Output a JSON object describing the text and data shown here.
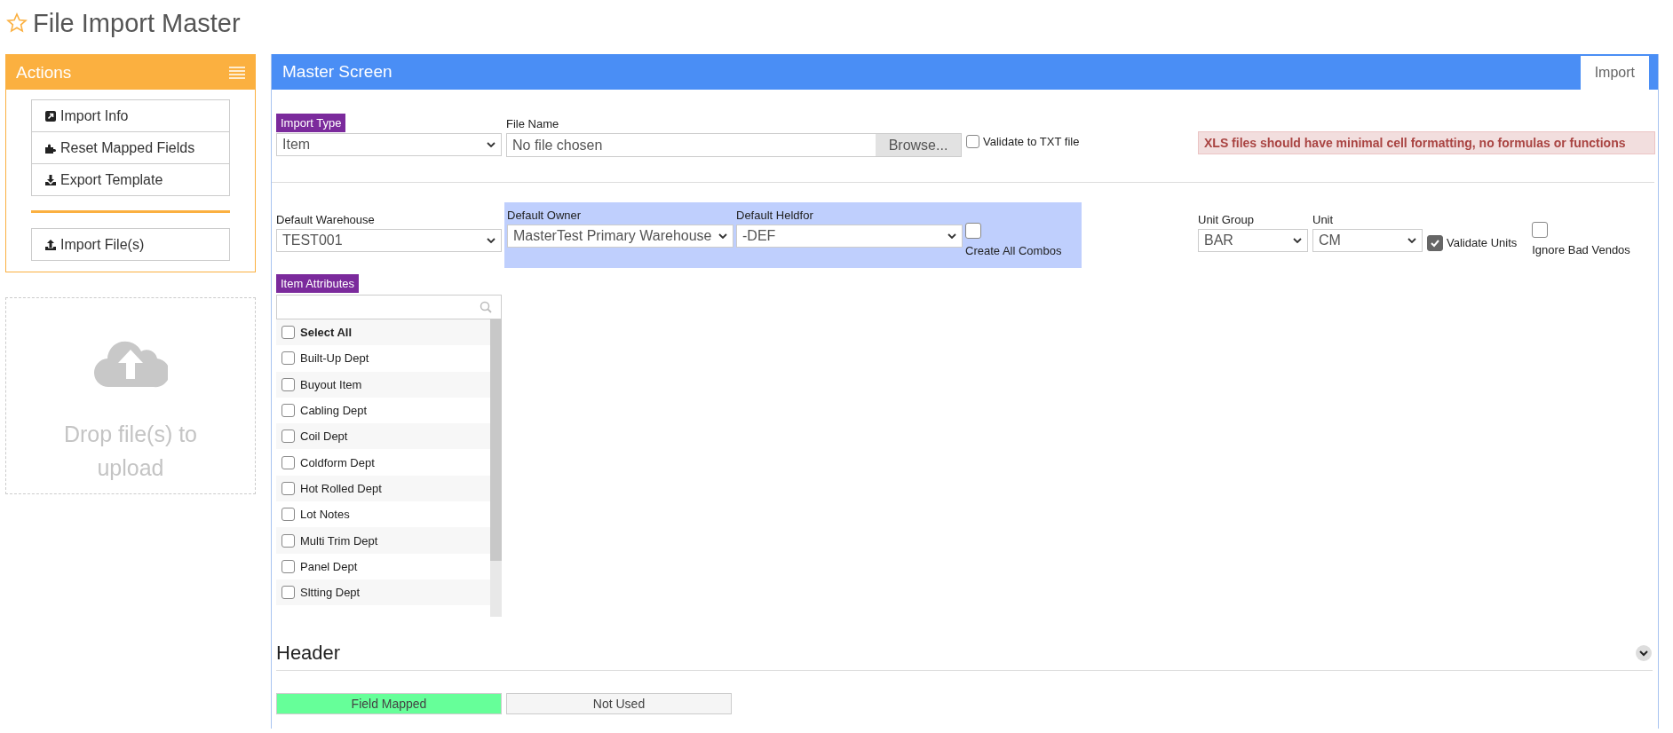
{
  "page": {
    "title": "File Import Master",
    "favorite": false
  },
  "actions": {
    "title": "Actions",
    "items": [
      {
        "label": "Import Info",
        "kind": "info"
      },
      {
        "label": "Reset Mapped Fields",
        "kind": "reset"
      },
      {
        "label": "Export Template",
        "kind": "export"
      }
    ],
    "upload_items": [
      {
        "label": "Import File(s)",
        "kind": "import"
      }
    ]
  },
  "drop_zone": {
    "text": "Drop file(s) to upload"
  },
  "main": {
    "title": "Master Screen",
    "tabs": [
      {
        "label": "Import",
        "selected": true
      }
    ]
  },
  "import_type": {
    "label": "Import Type",
    "value": "Item"
  },
  "file_name": {
    "label": "File Name",
    "value": "No file chosen",
    "button": "Browse..."
  },
  "validate_txt": {
    "label": "Validate to TXT file",
    "checked": false
  },
  "warning": "XLS files should have minimal cell formatting, no formulas or functions",
  "default_warehouse": {
    "label": "Default Warehouse",
    "value": "TEST001"
  },
  "default_owner": {
    "label": "Default Owner",
    "value": "MasterTest Primary Warehouse"
  },
  "default_heldfor": {
    "label": "Default Heldfor",
    "value": "-DEF"
  },
  "create_all_combos": {
    "label": "Create All Combos",
    "checked": false
  },
  "unit_group": {
    "label": "Unit Group",
    "value": "BAR"
  },
  "unit": {
    "label": "Unit",
    "value": "CM"
  },
  "validate_units": {
    "label": "Validate Units",
    "checked": true
  },
  "ignore_bad_vendos": {
    "label": "Ignore Bad Vendos",
    "checked": false
  },
  "item_attributes": {
    "label": "Item Attributes",
    "select_all": {
      "label": "Select All",
      "checked": false
    },
    "items": [
      {
        "label": "Built-Up Dept",
        "checked": false
      },
      {
        "label": "Buyout Item",
        "checked": false
      },
      {
        "label": "Cabling Dept",
        "checked": false
      },
      {
        "label": "Coil Dept",
        "checked": false
      },
      {
        "label": "Coldform Dept",
        "checked": false
      },
      {
        "label": "Hot Rolled Dept",
        "checked": false
      },
      {
        "label": "Lot Notes",
        "checked": false
      },
      {
        "label": "Multi Trim Dept",
        "checked": false
      },
      {
        "label": "Panel Dept",
        "checked": false
      },
      {
        "label": "Sltting Dept",
        "checked": false
      }
    ]
  },
  "header_section": {
    "title": "Header",
    "legend": [
      {
        "label": "Field Mapped",
        "color": "#66ff99"
      },
      {
        "label": "Not Used",
        "color": "#f5f5f5"
      }
    ]
  }
}
